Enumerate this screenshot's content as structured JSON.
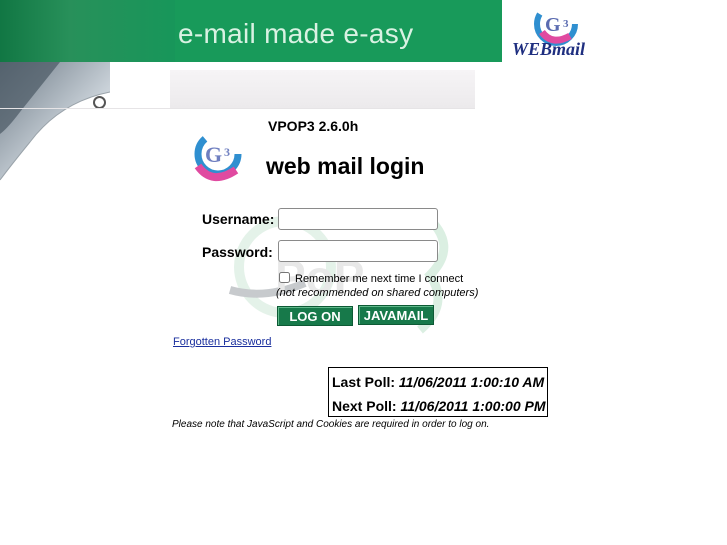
{
  "header": {
    "slogan": "e-mail made e-asy",
    "logo_text": "WEBmail"
  },
  "login": {
    "version": "VPOP3 2.6.0h",
    "title": "web mail login",
    "username_label": "Username:",
    "username_value": "",
    "password_label": "Password:",
    "password_value": "",
    "remember_label": "Remember me next time I connect",
    "remember_note": "(not recommended on shared computers)",
    "logon_button": "LOG ON",
    "javamail_button": "JAVAMAIL",
    "forgotten_link": "Forgotten Password"
  },
  "poll": {
    "last_label": "Last Poll:",
    "last_value": "11/06/2011 1:00:10 AM",
    "next_label": "Next Poll:",
    "next_value": "11/06/2011 1:00:00 PM"
  },
  "footer": {
    "note": "Please note that JavaScript and Cookies are required in order to log on."
  },
  "colors": {
    "brand_green": "#189a5a",
    "button_green": "#17794a",
    "logo_blue": "#2f8fd0",
    "logo_pink": "#e04aa0",
    "link_blue": "#1a2f9e"
  },
  "icons": {
    "brand_logo": "g3-logo",
    "watermark": "vpop3-watermark"
  }
}
